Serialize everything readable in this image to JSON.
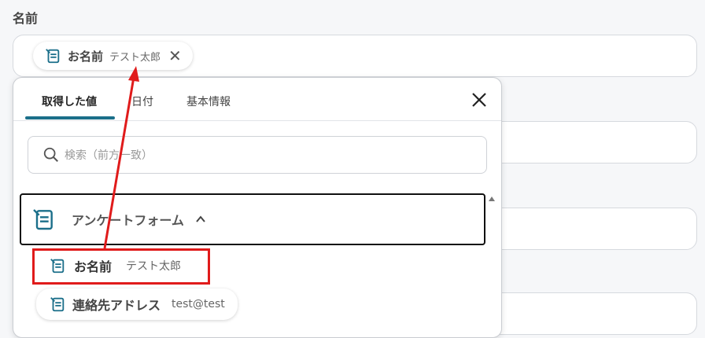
{
  "field": {
    "label": "名前"
  },
  "selected_chip": {
    "name": "お名前",
    "value": "テスト太郎"
  },
  "popup": {
    "tabs": [
      {
        "label": "取得した値",
        "active": true
      },
      {
        "label": "日付",
        "active": false
      },
      {
        "label": "基本情報",
        "active": false
      }
    ],
    "search_placeholder": "検索（前方一致）",
    "group": {
      "label": "アンケートフォーム",
      "expanded": true
    },
    "items": [
      {
        "name": "お名前",
        "value": "テスト太郎"
      },
      {
        "name": "連絡先アドレス",
        "value": "test@test"
      }
    ]
  },
  "colors": {
    "accent": "#1b6f8a",
    "highlight": "#e01b1b"
  }
}
